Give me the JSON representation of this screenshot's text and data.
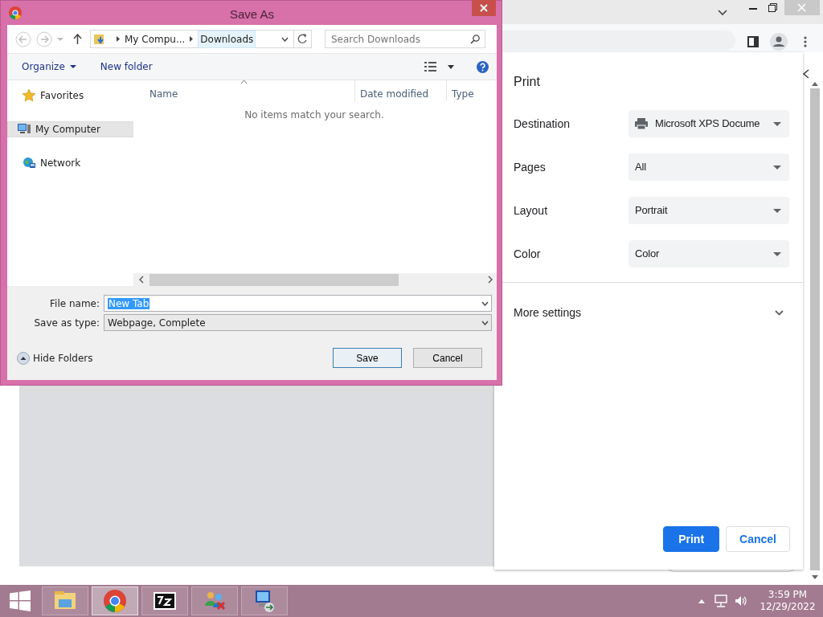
{
  "save_dialog": {
    "title": "Save As",
    "breadcrumb": [
      "My Compu...",
      "Downloads"
    ],
    "search": {
      "placeholder": "Search Downloads"
    },
    "toolbar": [
      "Organize",
      "New folder"
    ],
    "nav": [
      {
        "label": "Favorites",
        "kind": "star",
        "selected": false
      },
      {
        "label": "My Computer",
        "kind": "computer",
        "selected": true
      },
      {
        "label": "Network",
        "kind": "network",
        "selected": false
      }
    ],
    "columns": [
      {
        "label": "Name",
        "sorted": true
      },
      {
        "label": "Date modified",
        "sorted": false
      },
      {
        "label": "Type",
        "sorted": false
      }
    ],
    "empty_message": "No items match your search.",
    "fields": [
      {
        "label": "File name:",
        "value": "New Tab",
        "highlighted": true,
        "editable": true
      },
      {
        "label": "Save as type:",
        "value": "Webpage, Complete",
        "highlighted": false,
        "editable": false
      }
    ],
    "hide_folders": "Hide Folders",
    "buttons": [
      {
        "label": "Save",
        "default": true
      },
      {
        "label": "Cancel",
        "default": false
      }
    ]
  },
  "print": {
    "title": "Print",
    "settings": [
      {
        "label": "Destination",
        "value": "Microsoft XPS Docume",
        "kind": "printer"
      },
      {
        "label": "Pages",
        "value": "All",
        "kind": "plain"
      },
      {
        "label": "Layout",
        "value": "Portrait",
        "kind": "plain"
      },
      {
        "label": "Color",
        "value": "Color",
        "kind": "plain"
      }
    ],
    "more_settings": "More settings",
    "buttons": [
      {
        "label": "Print",
        "primary": true
      },
      {
        "label": "Cancel",
        "primary": false
      }
    ]
  },
  "taskbar": {
    "apps": [
      {
        "kind": "folder",
        "selected": false
      },
      {
        "kind": "chrome",
        "selected": true
      },
      {
        "kind": "archive",
        "selected": false
      },
      {
        "kind": "people",
        "selected": false
      },
      {
        "kind": "remote",
        "selected": false
      }
    ],
    "time": "3:59 PM",
    "date": "12/29/2022"
  }
}
